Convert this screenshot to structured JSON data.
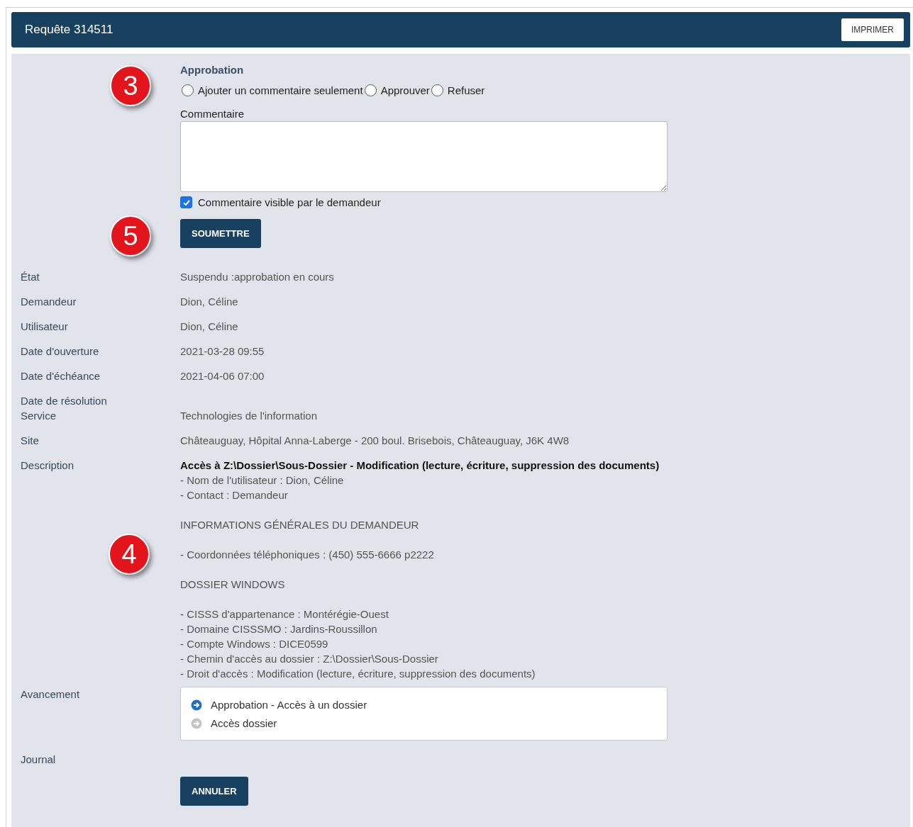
{
  "header": {
    "title": "Requête 314511",
    "print_button": "IMPRIMER"
  },
  "approval": {
    "heading": "Approbation",
    "options": [
      {
        "label": "Ajouter un commentaire seulement",
        "selected": false
      },
      {
        "label": "Approuver",
        "selected": false
      },
      {
        "label": "Refuser",
        "selected": false
      }
    ],
    "comment_label": "Commentaire",
    "visible_checkbox": {
      "label": "Commentaire visible par le demandeur",
      "checked": true
    },
    "submit_button": "SOUMETTRE"
  },
  "callouts": {
    "approval": "3",
    "submit": "5",
    "description": "4"
  },
  "fields": [
    {
      "label": "État",
      "value": "Suspendu :approbation en cours"
    },
    {
      "label": "Demandeur",
      "value": "Dion, Céline"
    },
    {
      "label": "Utilisateur",
      "value": "Dion, Céline"
    },
    {
      "label": "Date d'ouverture",
      "value": "2021-03-28 09:55"
    },
    {
      "label": "Date d'échéance",
      "value": "2021-04-06 07:00"
    },
    {
      "label": "Date de résolution"
    },
    {
      "label": "Service",
      "value": "Technologies de l'information"
    },
    {
      "label": "Site",
      "value": "Châteauguay, Hôpital Anna-Laberge - 200 boul. Brisebois, Châteauguay, J6K 4W8"
    }
  ],
  "description": {
    "label": "Description",
    "title": "Accès à Z:\\Dossier\\Sous-Dossier - Modification (lecture, écriture, suppression des documents)",
    "blocks": [
      [
        "- Nom de l'utilisateur : Dion, Céline",
        "- Contact : Demandeur"
      ],
      [
        "INFORMATIONS GÉNÉRALES DU DEMANDEUR"
      ],
      [
        "- Coordonnées téléphoniques : (450) 555-6666 p2222"
      ],
      [
        "DOSSIER WINDOWS"
      ],
      [
        "- CISSS d'appartenance : Montérégie-Ouest",
        "- Domaine CISSSMO : Jardins-Roussillon",
        "- Compte Windows : DICE0599",
        "- Chemin d'accès au dossier : Z:\\Dossier\\Sous-Dossier",
        "- Droit d'accès : Modification (lecture, écriture, suppression des documents)"
      ]
    ]
  },
  "progress": {
    "label": "Avancement",
    "steps": [
      {
        "label": "Approbation - Accès à un dossier",
        "kind": "current"
      },
      {
        "label": "Accès dossier",
        "kind": "pending"
      }
    ]
  },
  "journal": {
    "label": "Journal"
  },
  "cancel_button": "ANNULER"
}
